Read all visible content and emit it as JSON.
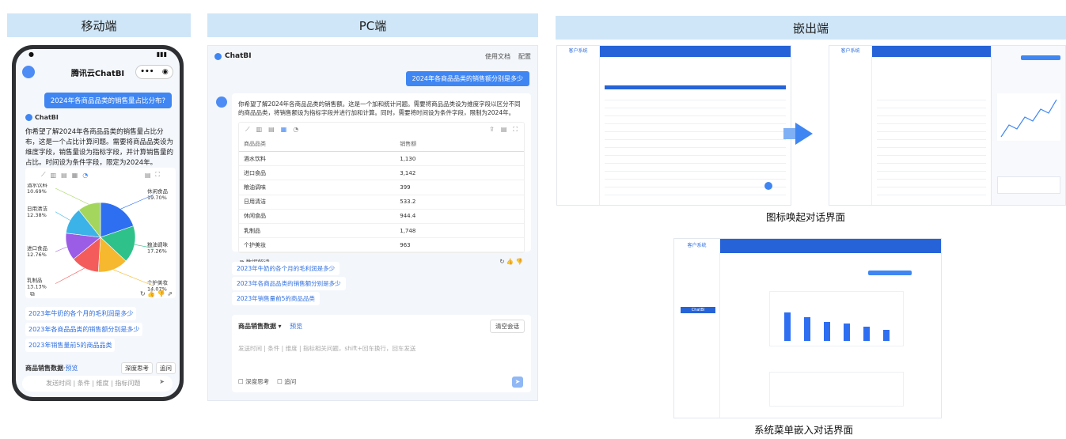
{
  "sections": {
    "mobile": "移动端",
    "pc": "PC端",
    "embed": "嵌出端"
  },
  "mobile": {
    "app_title": "腾讯云ChatBI",
    "capsule": "•••",
    "question": "2024年各商品品类的销售量占比分布?",
    "brand": "ChatBI",
    "answer": "你希望了解2024年各商品品类的销售量占比分布，这是一个占比计算问题。需要将商品品类设为维度字段，销售量设为指标字段，并计算销售量的占比。时间设为条件字段，限定为2024年。",
    "pie": [
      {
        "label": "休闲食品",
        "value": 19.7,
        "color": "#2e6ff2"
      },
      {
        "label": "粮油调味",
        "value": 17.26,
        "color": "#2ec28a"
      },
      {
        "label": "个护美妆",
        "value": 14.07,
        "color": "#f5b82e"
      },
      {
        "label": "乳制品",
        "value": 13.13,
        "color": "#f45c5c"
      },
      {
        "label": "进口食品",
        "value": 12.76,
        "color": "#9b5de5"
      },
      {
        "label": "日用清洁",
        "value": 12.38,
        "color": "#3bb3e8"
      },
      {
        "label": "酒水饮料",
        "value": 10.69,
        "color": "#a4d65e"
      }
    ],
    "suggestions": [
      "2023年牛奶的各个月的毛利润是多少",
      "2023年各商品品类的销售额分别是多少",
      "2023年销售量前5的商品品类"
    ],
    "dataset": "商品销售数据",
    "preview": "预览",
    "deep_think": "深度思考",
    "followup": "追问",
    "input_placeholder": "发送时间 | 条件 | 维度 | 指标问题"
  },
  "pc": {
    "brand": "ChatBI",
    "doc_link": "使用文档",
    "settings": "配置",
    "question": "2024年各商品品类的销售额分别是多少",
    "answer": "你希望了解2024年各商品品类的销售额。这是一个加和统计问题。需要将商品品类设为维度字段以区分不同的商品品类，将销售额设为指标字段并进行加和计算。同时，需要将时间设为条件字段，限制为2024年。",
    "table_headers": [
      "商品品类",
      "销售额"
    ],
    "table_rows": [
      [
        "酒水饮料",
        "1,130"
      ],
      [
        "进口食品",
        "3,142"
      ],
      [
        "粮油调味",
        "399"
      ],
      [
        "日用清洁",
        "533.2"
      ],
      [
        "休闲食品",
        "944.4"
      ],
      [
        "乳制品",
        "1,748"
      ],
      [
        "个护美妆",
        "963"
      ]
    ],
    "interpret": "数据解读",
    "suggestions": [
      "2023年牛奶的各个月的毛利润是多少",
      "2023年各商品品类的销售额分别是多少",
      "2023年销售量前5的商品品类"
    ],
    "dataset": "商品销售数据",
    "preview": "预览",
    "clear": "清空会话",
    "placeholder": "发送时间 | 条件 | 维度 | 指标相关问题，shift+回车换行，回车发送",
    "deep_think": "深度思考",
    "followup": "追问"
  },
  "embed": {
    "app_name": "客户系统",
    "caption_icon": "图标唤起对话界面",
    "caption_menu": "系统菜单嵌入对话界面",
    "menu_item": "ChatBI"
  }
}
